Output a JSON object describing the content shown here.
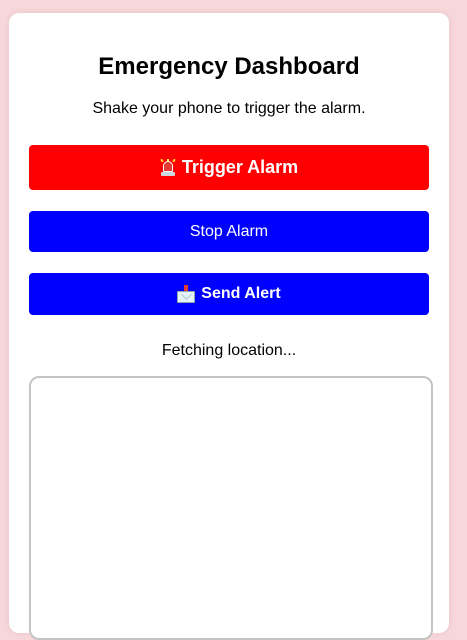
{
  "dashboard": {
    "title": "Emergency Dashboard",
    "subtitle": "Shake your phone to trigger the alarm."
  },
  "buttons": {
    "trigger_icon": "police-siren-icon",
    "trigger_label": "Trigger Alarm",
    "stop_label": "Stop Alarm",
    "send_icon": "envelope-with-arrow-icon",
    "send_label": "Send Alert"
  },
  "location": {
    "status": "Fetching location..."
  },
  "colors": {
    "background": "#f8d7da",
    "trigger": "#ff0000",
    "stop": "#0000ff",
    "send": "#0000ff"
  }
}
